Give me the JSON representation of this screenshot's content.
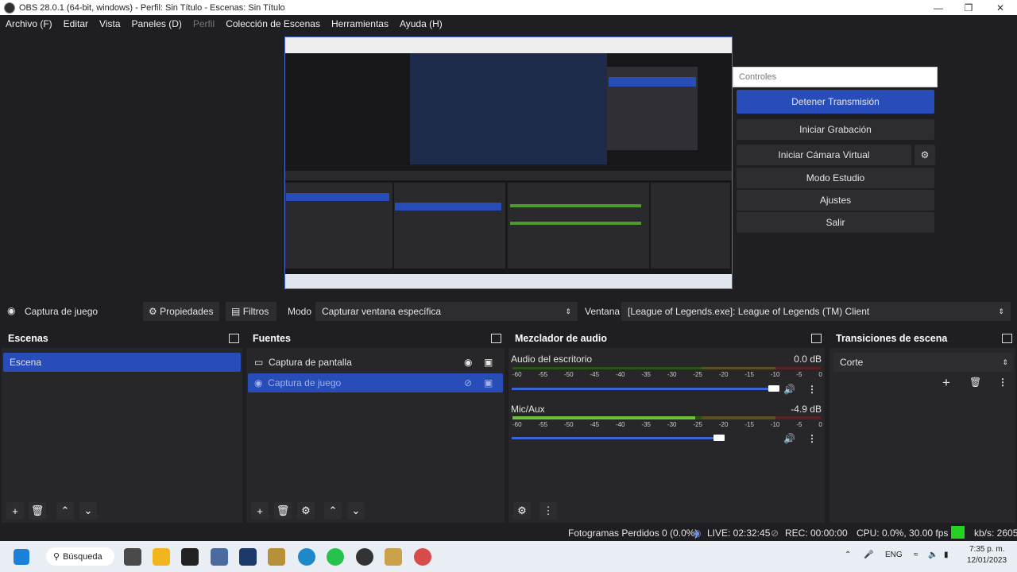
{
  "window": {
    "title": "OBS 28.0.1 (64-bit, windows) - Perfil: Sin Título - Escenas: Sin Título"
  },
  "menu": [
    {
      "label": "Archivo (F)",
      "disabled": false
    },
    {
      "label": "Editar",
      "disabled": false
    },
    {
      "label": "Vista",
      "disabled": false
    },
    {
      "label": "Paneles (D)",
      "disabled": false
    },
    {
      "label": "Perfil",
      "disabled": true
    },
    {
      "label": "Colección de Escenas",
      "disabled": false
    },
    {
      "label": "Herramientas",
      "disabled": false
    },
    {
      "label": "Ayuda (H)",
      "disabled": false
    }
  ],
  "controls": {
    "title": "Controles",
    "stop_stream": "Detener Transmisión",
    "start_recording": "Iniciar Grabación",
    "start_virtualcam": "Iniciar Cámara Virtual",
    "studio_mode": "Modo Estudio",
    "settings": "Ajustes",
    "exit": "Salir"
  },
  "sourcebar": {
    "source_name": "Captura de juego",
    "properties": "Propiedades",
    "filters": "Filtros",
    "mode_label": "Modo",
    "mode_value": "Capturar ventana específica",
    "window_label": "Ventana",
    "window_value": "[League of Legends.exe]: League of Legends (TM) Client"
  },
  "scenes": {
    "title": "Escenas",
    "items": [
      {
        "label": "Escena"
      }
    ]
  },
  "sources": {
    "title": "Fuentes",
    "items": [
      {
        "label": "Captura de pantalla"
      },
      {
        "label": "Captura de juego"
      }
    ]
  },
  "mixer": {
    "title": "Mezclador de audio",
    "channels": [
      {
        "name": "Audio del escritorio",
        "db": "0.0 dB",
        "level": 0.0,
        "volume": 0.97
      },
      {
        "name": "Mic/Aux",
        "db": "-4.9 dB",
        "level": 0.58,
        "volume": 0.84
      }
    ],
    "scale": [
      "-60",
      "-55",
      "-50",
      "-45",
      "-40",
      "-35",
      "-30",
      "-25",
      "-20",
      "-15",
      "-10",
      "-5",
      "0"
    ]
  },
  "transitions": {
    "title": "Transiciones de escena",
    "value": "Corte"
  },
  "status": {
    "dropped": "Fotogramas Perdidos 0 (0.0%)",
    "live": "LIVE: 02:32:45",
    "rec": "REC: 00:00:00",
    "cpu": "CPU: 0.0%, 30.00 fps",
    "kbs": "kb/s: 2605"
  },
  "taskbar": {
    "search": "Búsqueda",
    "lang": "ENG",
    "time": "7:35 p. m.",
    "date": "12/01/2023"
  },
  "colors": {
    "accent": "#284cb8",
    "meter_green": "#4c9a2a",
    "meter_yellow": "#b9a23c",
    "meter_red": "#b23c3c"
  }
}
